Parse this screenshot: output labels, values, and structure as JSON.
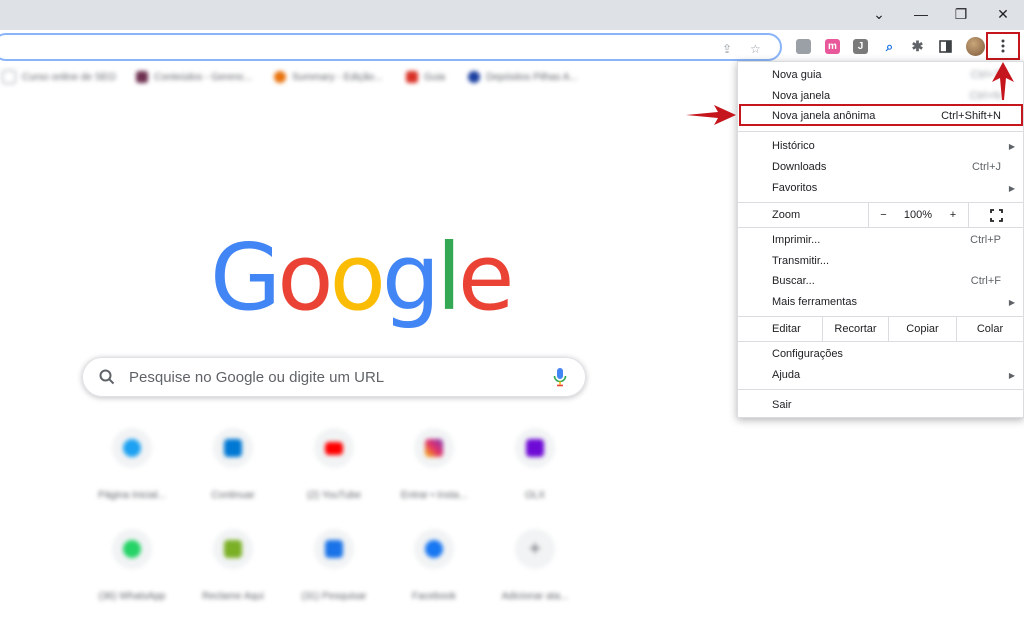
{
  "menu": {
    "items": [
      {
        "label": "Nova guia",
        "shortcut": "Ctrl+T"
      },
      {
        "label": "Nova janela",
        "shortcut": "Ctrl+N"
      },
      {
        "label": "Nova janela anônima",
        "shortcut": "Ctrl+Shift+N"
      },
      {
        "label": "Histórico"
      },
      {
        "label": "Downloads",
        "shortcut": "Ctrl+J"
      },
      {
        "label": "Favoritos"
      },
      {
        "label": "Zoom"
      },
      {
        "label": "Imprimir...",
        "shortcut": "Ctrl+P"
      },
      {
        "label": "Transmitir..."
      },
      {
        "label": "Buscar...",
        "shortcut": "Ctrl+F"
      },
      {
        "label": "Mais ferramentas"
      },
      {
        "label": "Configurações"
      },
      {
        "label": "Ajuda"
      },
      {
        "label": "Sair"
      }
    ],
    "zoom": {
      "minus": "−",
      "value": "100%",
      "plus": "+"
    },
    "edit": {
      "label": "Editar",
      "cut": "Recortar",
      "copy": "Copiar",
      "paste": "Colar"
    }
  },
  "bookmarks": [
    {
      "label": "Curso online de SEO",
      "color": "#9aa0a6"
    },
    {
      "label": "Conteúdos - Gerenc...",
      "color": "#6d2f4f"
    },
    {
      "label": "Summary - Edição...",
      "color": "#e8710a"
    },
    {
      "label": "Guia",
      "color": "#d93025"
    },
    {
      "label": "Depósitos Pilhas A...",
      "color": "#1a3fa0"
    }
  ],
  "search": {
    "placeholder": "Pesquise no Google ou digite um URL"
  },
  "logo": {
    "letters": [
      "G",
      "o",
      "o",
      "g",
      "l",
      "e"
    ],
    "colors": [
      "#4285f4",
      "#ea4335",
      "#fbbc05",
      "#4285f4",
      "#34a853",
      "#ea4335"
    ]
  },
  "shortcuts": [
    {
      "label": "Página Inicial...",
      "color": "#1da1f2"
    },
    {
      "label": "Continuar",
      "color": "#0078d4"
    },
    {
      "label": "(2) YouTube",
      "color": "#ff0000"
    },
    {
      "label": "Entrar • Insta...",
      "color": "#e1306c"
    },
    {
      "label": "OLX",
      "color": "#6e0ad6"
    },
    {
      "label": "(36) WhatsApp",
      "color": "#25d366"
    },
    {
      "label": "Reclame Aqui",
      "color": "#7bb026"
    },
    {
      "label": "(31) Pesquisar",
      "color": "#1a73e8"
    },
    {
      "label": "Facebook",
      "color": "#1877f2"
    },
    {
      "label": "Adicionar ata...",
      "color": "#5f6368"
    }
  ],
  "extensions": [
    {
      "icon": "m-extension-icon",
      "glyph": "m",
      "color": "#e8589a"
    },
    {
      "icon": "j-extension-icon",
      "glyph": "J",
      "color": "#7a7a7a"
    }
  ],
  "colors": {
    "highlight": "#c4161c",
    "accent": "#8ab4f8"
  }
}
